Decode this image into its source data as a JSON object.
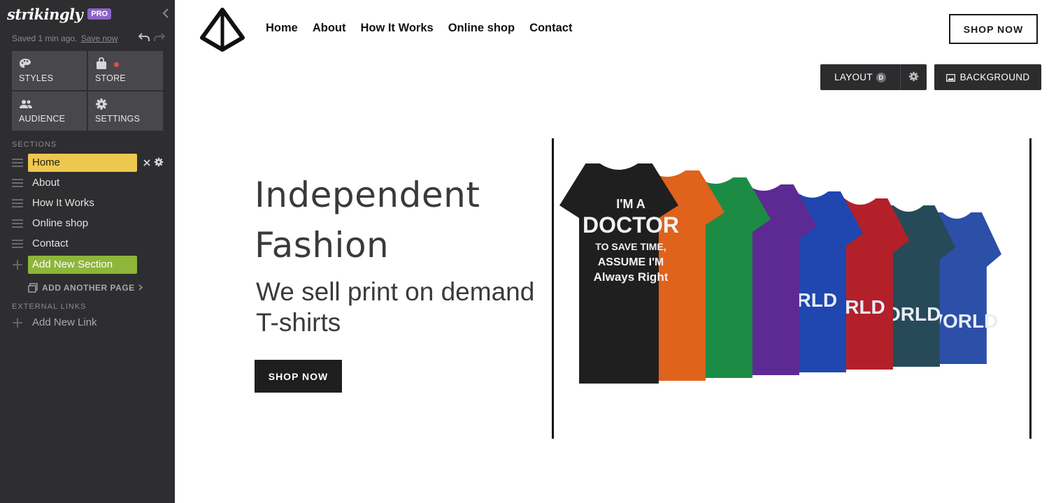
{
  "sidebar": {
    "logo": "strikingly",
    "badge": "PRO",
    "saved_text": "Saved 1 min ago.",
    "save_now": "Save now",
    "tiles": [
      {
        "label": "STYLES",
        "icon": "palette-icon"
      },
      {
        "label": "STORE",
        "icon": "shopping-bag-icon"
      },
      {
        "label": "AUDIENCE",
        "icon": "people-icon"
      },
      {
        "label": "SETTINGS",
        "icon": "gear-icon"
      }
    ],
    "sections_heading": "SECTIONS",
    "sections": [
      "Home",
      "About",
      "How It Works",
      "Online shop",
      "Contact"
    ],
    "add_section": "Add New Section",
    "add_page": "ADD ANOTHER PAGE",
    "external_heading": "EXTERNAL LINKS",
    "add_link": "Add New Link"
  },
  "site": {
    "nav": [
      "Home",
      "About",
      "How It Works",
      "Online shop",
      "Contact"
    ],
    "header_button": "SHOP NOW",
    "editor": {
      "layout_label": "LAYOUT",
      "layout_badge": "D",
      "background_label": "BACKGROUND"
    },
    "hero": {
      "title": "Independent Fashion",
      "subtitle": "We sell print on demand T-shirts",
      "button": "SHOP NOW"
    },
    "shirts": {
      "colors": [
        "#1f1f1f",
        "#e0621b",
        "#1c8c45",
        "#5d2a93",
        "#2046b0",
        "#b3202a",
        "#274a58",
        "#2c4fa8"
      ],
      "front_text": [
        "I'M A",
        "DOCTOR",
        "TO SAVE TIME,",
        "ASSUME I'M",
        "Always Right"
      ],
      "side_text": [
        "RLD",
        "RLD",
        "ORLD",
        "WORLD"
      ]
    }
  },
  "colors": {
    "sidebar_bg": "#2e2e30",
    "active_section": "#eec84e",
    "add_section": "#8db63a",
    "pro_badge": "#8e63c6"
  }
}
